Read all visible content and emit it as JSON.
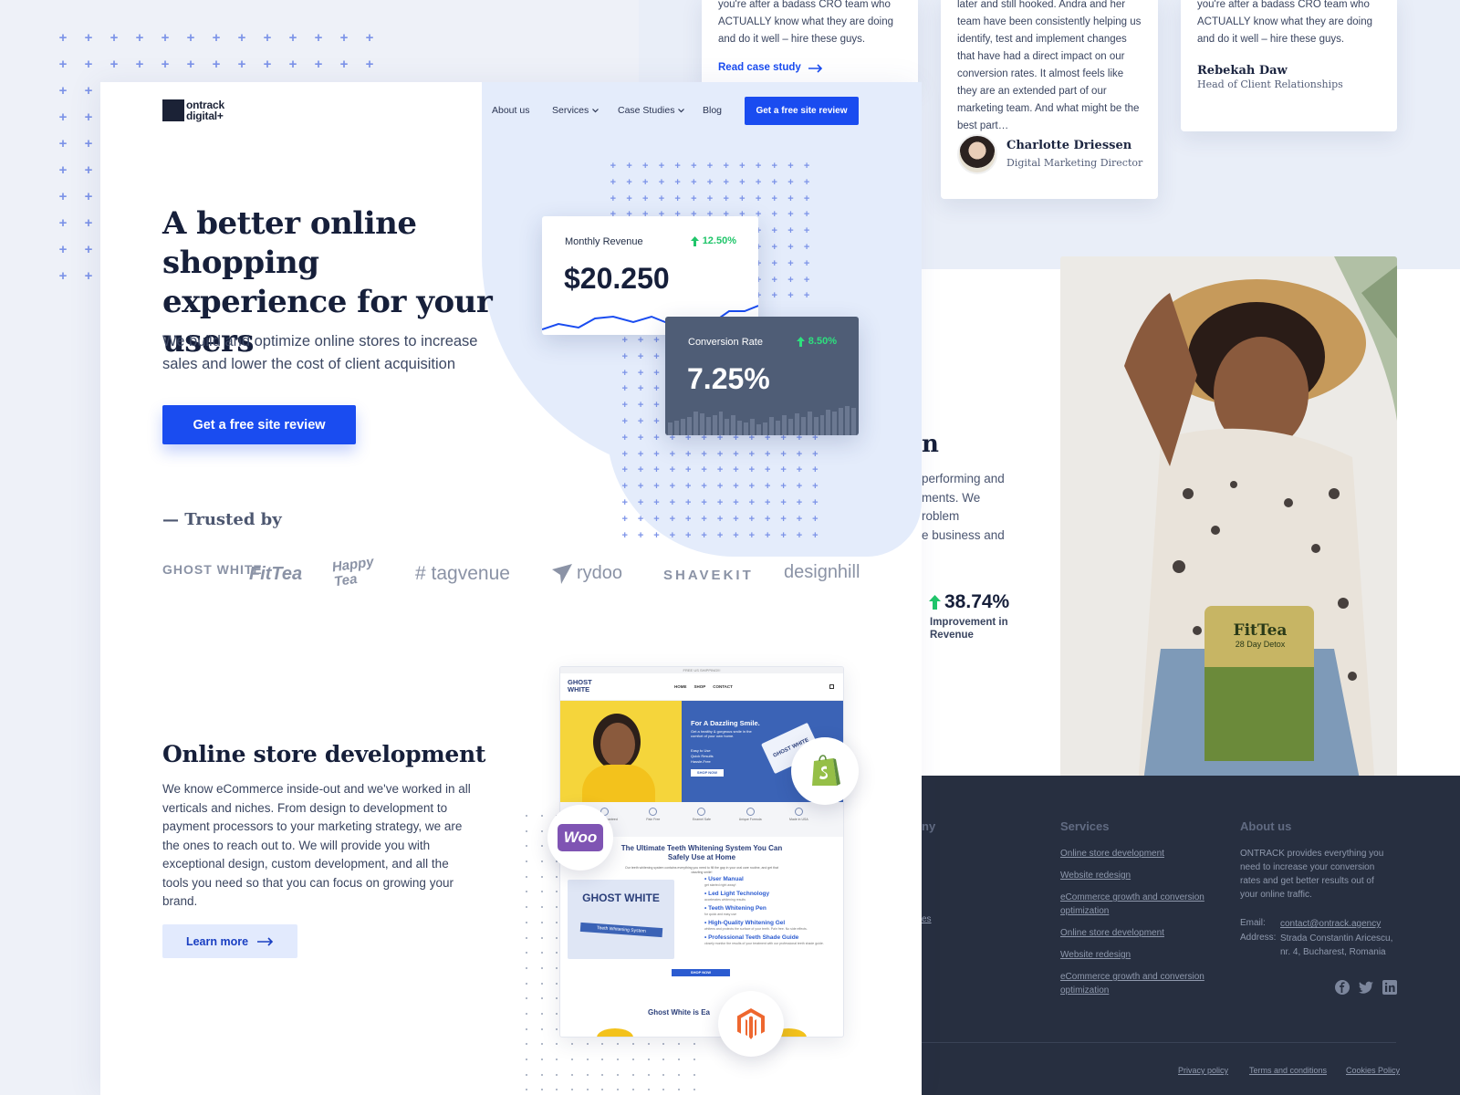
{
  "brand": {
    "name_line1": "ontrack",
    "name_line2": "digital+"
  },
  "nav": {
    "about": "About us",
    "services": "Services",
    "case_studies": "Case Studies",
    "blog": "Blog",
    "cta": "Get a free site review"
  },
  "hero": {
    "title": "A better online shopping experience for your users",
    "subtitle": "We build and optimize online stores to increase sales and lower the cost of client acquisition",
    "cta": "Get a free site review"
  },
  "widgets": {
    "revenue": {
      "label": "Monthly Revenue",
      "change": "12.50%",
      "value": "$20.250"
    },
    "conversion": {
      "label": "Conversion Rate",
      "change": "8.50%",
      "value": "7.25%"
    }
  },
  "trusted": {
    "heading": "— Trusted by",
    "logos": [
      "GHOST WHITE",
      "FitTea",
      "Happy Tea",
      "# tagvenue",
      "rydoo",
      "SHAVEKIT",
      "designhill"
    ]
  },
  "store_dev": {
    "title": "Online store development",
    "body": "We know eCommerce inside-out and we've worked in all verticals and niches. From design to development to payment processors to your marketing strategy, we are the ones to reach out to. We will provide you with exceptional design, custom development, and all the tools you need so that you can focus on growing your brand.",
    "cta": "Learn more"
  },
  "mockup": {
    "topbar": "FREE US SHIPPING!!!",
    "logo": "GHOST WHITE",
    "menu": [
      "HOME",
      "SHOP",
      "CONTACT"
    ],
    "hero_title": "For A Dazzling Smile.",
    "hero_text": "Get a healthy & gorgeous smile in the comfort of your own home.",
    "hero_bullets": [
      "Easy to Use",
      "Quick Results",
      "Hassle-Free"
    ],
    "hero_btn": "SHOP NOW",
    "features": [
      "100% Guaranteed Results",
      "Pain Free",
      "Enamel Safe",
      "Unique Formula",
      "Made in USA"
    ],
    "section_title": "The Ultimate Teeth Whitening System You Can Safely Use at Home",
    "section_sub": "Our teeth whitening system contains everything you need to fill the gap in your oral care routine, and get that dazzling smile!",
    "list": [
      {
        "title": "User Manual",
        "text": "get started right away!"
      },
      {
        "title": "Led Light Technology",
        "text": "accelerates whitening results"
      },
      {
        "title": "Teeth Whitening Pen",
        "text": "for quick and easy use"
      },
      {
        "title": "High-Quality Whitening Gel",
        "text": "whitens and protects the surface of your teeth. Pain free. No side effects."
      },
      {
        "title": "Professional Teeth Shade Guide",
        "text": "closely monitor the results of your treatment with our professional teeth shade guide."
      }
    ],
    "product_label": "GHOST WHITE",
    "product_sub": "Teeth Whitening System",
    "shop_btn": "SHOP NOW",
    "footer_text": "Ghost White is Ea"
  },
  "integrations": {
    "woo": "Woo"
  },
  "testimonials": [
    {
      "text": "you're after a badass CRO team who ACTUALLY know what they are doing and do it well – hire these guys.",
      "link": "Read case study"
    },
    {
      "text": "later and still hooked. Andra and her team have been consistently helping us identify, test and implement changes that have had a direct impact on our conversion rates. It almost feels like they are an extended part of our marketing team. And what might be the best part…",
      "name": "Charlotte Driessen",
      "role": "Digital Marketing Director"
    },
    {
      "text": "you're after a badass CRO team who ACTUALLY know what they are doing and do it well – hire these guys.",
      "name": "Rebekah Daw",
      "role": "Head of Client Relationships"
    }
  ],
  "case_peek": {
    "heading_fragment": "n",
    "lines": [
      "performing and",
      "ments. We",
      "roblem",
      "e business and"
    ],
    "stat": "38.74%",
    "stat_label": "Improvement in Revenue"
  },
  "product_photo": {
    "brand": "FitTea",
    "sub": "28 Day Detox"
  },
  "footer": {
    "col1_fragment": "ny",
    "col1_link_fragment": "es",
    "services_heading": "Services",
    "services_links": [
      "Online store development",
      "Website redesign",
      "eCommerce growth and conversion optimization",
      "Online store development",
      "Website redesign",
      "eCommerce growth and conversion optimization"
    ],
    "about_heading": "About us",
    "about_text": "ONTRACK provides everything you need to increase your conversion rates and get better results out of your online traffic.",
    "email_label": "Email:",
    "email": "contact@ontrack.agency",
    "address_label": "Address:",
    "address": "Strada Constantin Aricescu, nr. 4, Bucharest, Romania",
    "legal": [
      "Privacy policy",
      "Terms and conditions",
      "Cookies Policy"
    ],
    "social": [
      "facebook-icon",
      "twitter-icon",
      "linkedin-icon"
    ]
  },
  "colors": {
    "accent": "#1a4cf0",
    "positive": "#20c56a",
    "dark_footer": "#272f40",
    "blob": "#e4ecfb"
  }
}
